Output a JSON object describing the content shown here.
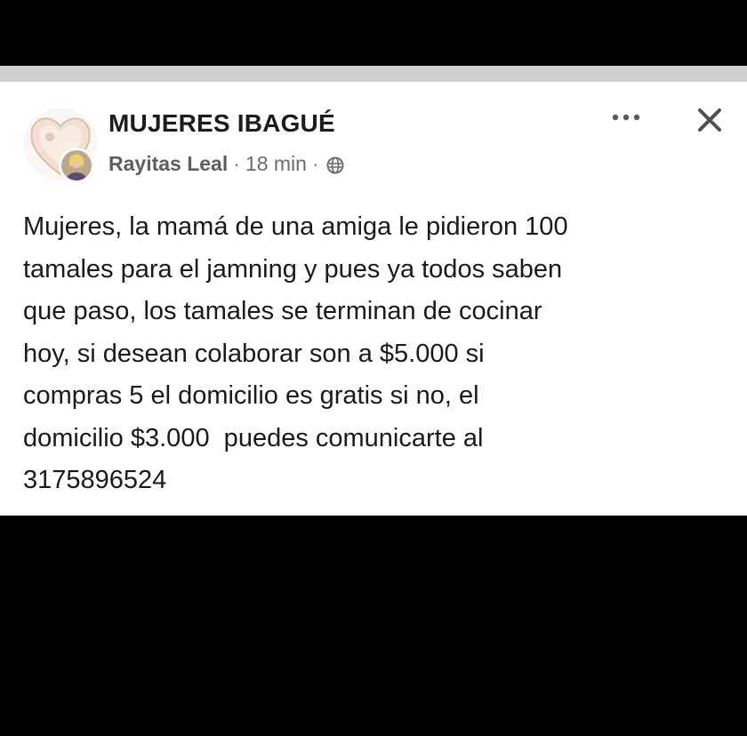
{
  "post": {
    "group_name": "MUJERES IBAGUÉ",
    "author": "Rayitas Leal",
    "separator_1": "·",
    "time": "18 min",
    "separator_2": "·",
    "audience_icon": "globe-icon",
    "menu_icon": "more-horizontal-icon",
    "close_icon": "close-icon",
    "body": "Mujeres, la mamá de una amiga le pidieron 100\ntamales para el jamning y pues ya todos saben\nque paso, los tamales se terminan de cocinar\nhoy, si desean colaborar son a $5.000 si\ncompras 5 el domicilio es gratis si no, el\ndomicilio $3.000  puedes comunicarte al\n3175896524"
  },
  "colors": {
    "background": "#000000",
    "card": "#ffffff",
    "strip": "#cfcfcf",
    "text": "#1a1a1a",
    "meta_text": "#6b6b6b"
  }
}
